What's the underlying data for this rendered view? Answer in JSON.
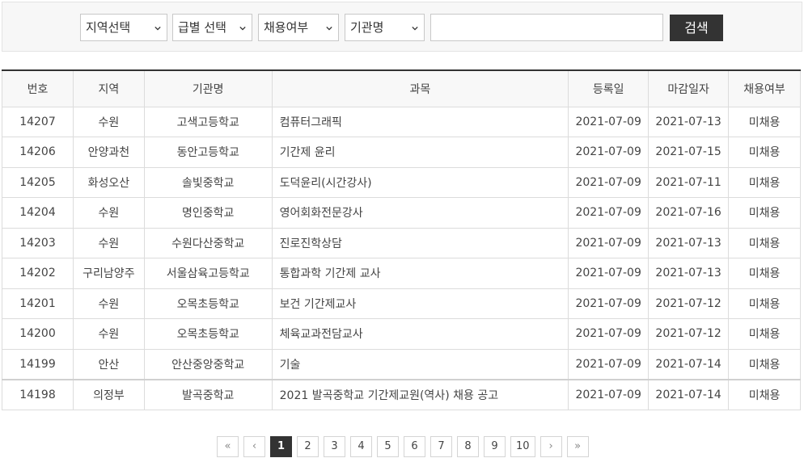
{
  "search": {
    "region_label": "지역선택",
    "grade_label": "급별 선택",
    "hire_status_label": "채용여부",
    "agency_label": "기관명",
    "keyword_value": "",
    "submit_label": "검색"
  },
  "table": {
    "headers": [
      "번호",
      "지역",
      "기관명",
      "과목",
      "등록일",
      "마감일자",
      "채용여부"
    ],
    "rows": [
      [
        "14207",
        "수원",
        "고색고등학교",
        "컴퓨터그래픽",
        "2021-07-09",
        "2021-07-13",
        "미채용"
      ],
      [
        "14206",
        "안양과천",
        "동안고등학교",
        "기간제 윤리",
        "2021-07-09",
        "2021-07-15",
        "미채용"
      ],
      [
        "14205",
        "화성오산",
        "솔빛중학교",
        "도덕윤리(시간강사)",
        "2021-07-09",
        "2021-07-11",
        "미채용"
      ],
      [
        "14204",
        "수원",
        "명인중학교",
        "영어회화전문강사",
        "2021-07-09",
        "2021-07-16",
        "미채용"
      ],
      [
        "14203",
        "수원",
        "수원다산중학교",
        "진로진학상담",
        "2021-07-09",
        "2021-07-13",
        "미채용"
      ],
      [
        "14202",
        "구리남양주",
        "서울삼육고등학교",
        "통합과학 기간제 교사",
        "2021-07-09",
        "2021-07-13",
        "미채용"
      ],
      [
        "14201",
        "수원",
        "오목초등학교",
        "보건 기간제교사",
        "2021-07-09",
        "2021-07-12",
        "미채용"
      ],
      [
        "14200",
        "수원",
        "오목초등학교",
        "체육교과전담교사",
        "2021-07-09",
        "2021-07-12",
        "미채용"
      ],
      [
        "14199",
        "안산",
        "안산중앙중학교",
        "기술",
        "2021-07-09",
        "2021-07-14",
        "미채용"
      ],
      [
        "14198",
        "의정부",
        "발곡중학교",
        "2021 발곡중학교 기간제교원(역사) 채용 공고",
        "2021-07-09",
        "2021-07-14",
        "미채용"
      ]
    ]
  },
  "pagination": {
    "first": "«",
    "prev": "‹",
    "pages": [
      "1",
      "2",
      "3",
      "4",
      "5",
      "6",
      "7",
      "8",
      "9",
      "10"
    ],
    "current": "1",
    "next": "›",
    "last": "»"
  }
}
